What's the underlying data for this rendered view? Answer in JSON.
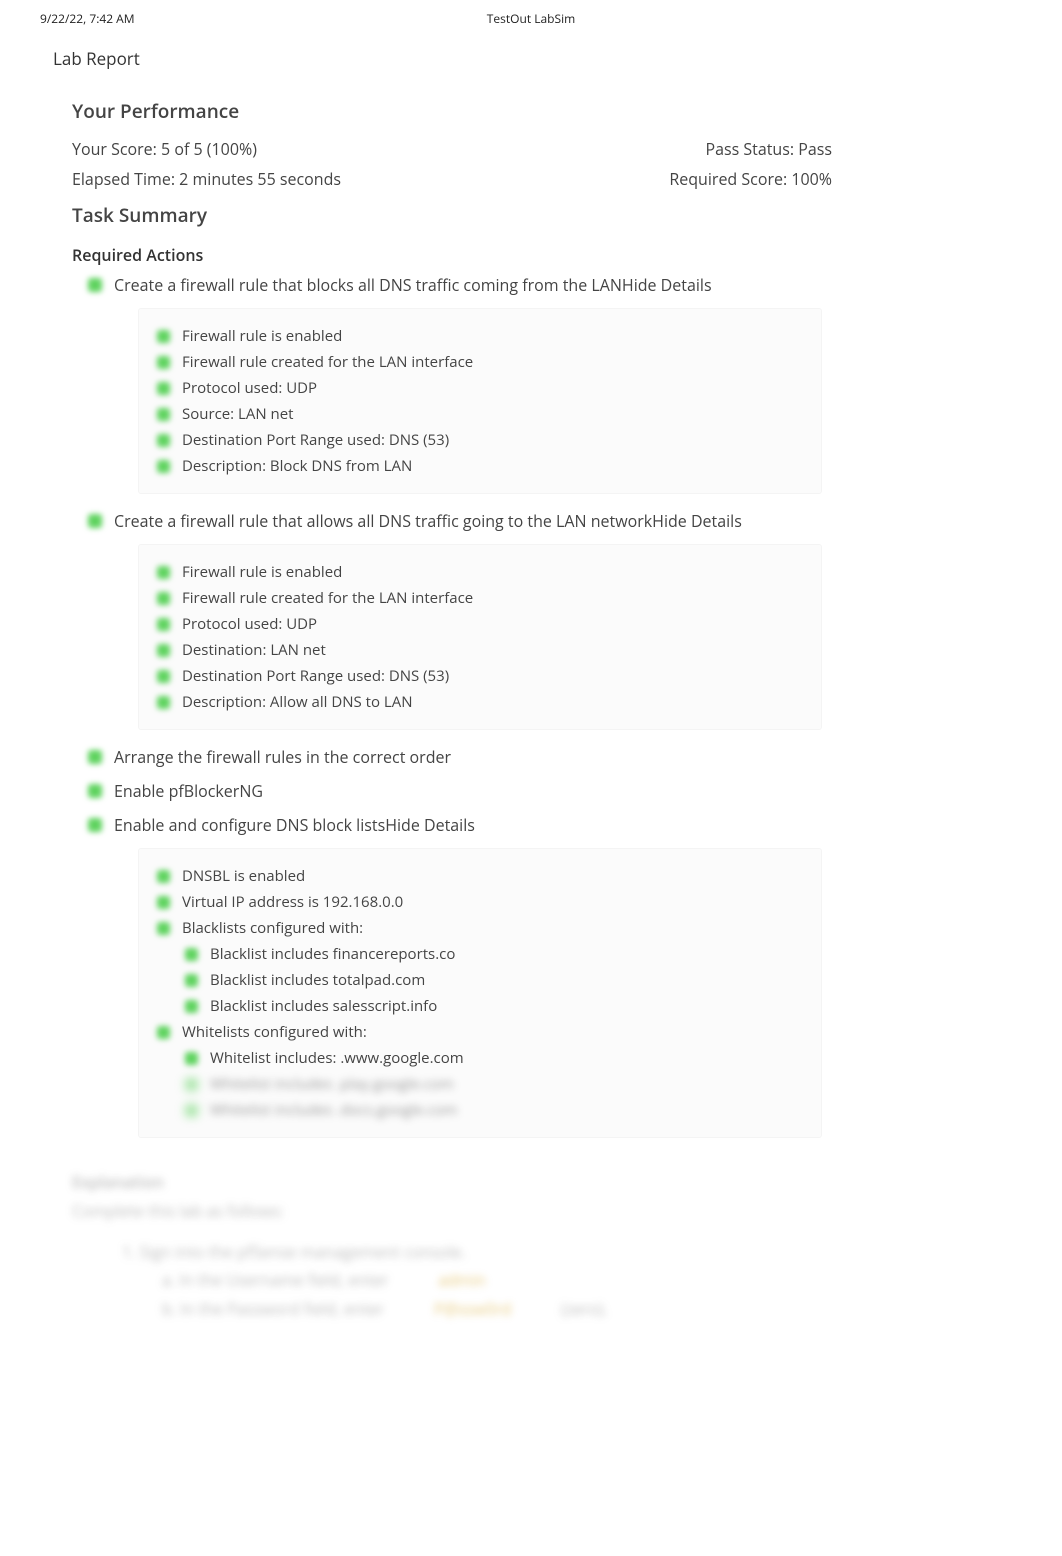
{
  "header": {
    "timestamp": "9/22/22, 7:42 AM",
    "app_title": "TestOut LabSim"
  },
  "report": {
    "title": "Lab Report",
    "performance_heading": "Your Performance",
    "score_label": "Your Score: 5 of 5 (100%)",
    "pass_status": "Pass Status: Pass",
    "elapsed_time": "Elapsed Time: 2 minutes 55 seconds",
    "required_score": "Required Score: 100%",
    "task_summary_heading": "Task Summary",
    "required_actions_heading": "Required Actions"
  },
  "actions": {
    "a1": {
      "text": "Create a firewall rule that blocks all DNS traffic coming from the LAN",
      "toggle": "Hide Details",
      "details": [
        "Firewall rule is enabled",
        "Firewall rule created for the LAN interface",
        "Protocol used: UDP",
        "Source: LAN net",
        "Destination Port Range used: DNS (53)",
        "Description: Block DNS from LAN"
      ]
    },
    "a2": {
      "text": "Create a firewall rule that allows all DNS traffic going to the LAN network",
      "toggle": "Hide Details",
      "details": [
        "Firewall rule is enabled",
        "Firewall rule created for the LAN interface",
        "Protocol used: UDP",
        "Destination: LAN net",
        "Destination Port Range used: DNS (53)",
        "Description: Allow all DNS to LAN"
      ]
    },
    "a3": {
      "text": "Arrange the firewall rules in the correct order"
    },
    "a4": {
      "text": "Enable pfBlockerNG"
    },
    "a5": {
      "text": "Enable and configure DNS block lists",
      "toggle": "Hide Details",
      "details_top": [
        "DNSBL is enabled",
        "Virtual IP address is 192.168.0.0",
        "Blacklists configured with:"
      ],
      "blacklist_items": [
        "Blacklist includes financereports.co",
        "Blacklist includes totalpad.com",
        "Blacklist includes salesscript.info"
      ],
      "whitelist_heading": "Whitelists configured with:",
      "whitelist_items": [
        "Whitelist includes: .www.google.com"
      ],
      "whitelist_blurred": [
        "Whitelist includes .play.google.com",
        "Whitelist includes .docs.google.com"
      ]
    }
  },
  "explanation": {
    "heading": "Explanation",
    "subheading": "Complete this lab as follows:",
    "step1": "1. Sign into the pfSense management console.",
    "sub1a": "a. In the Username field, enter",
    "sub1a_val": "admin",
    "sub1b": "b. In the Password field, enter",
    "sub1b_val": "P@ssw0rd",
    "sub1b_sens": "(zero)."
  }
}
